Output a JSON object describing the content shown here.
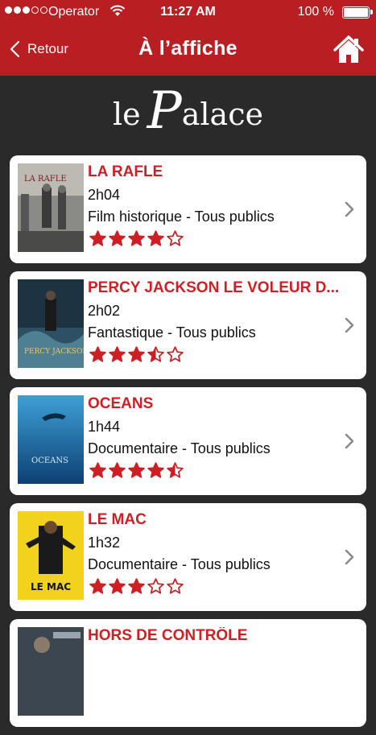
{
  "status_bar": {
    "carrier": "Operator",
    "time": "11:27 AM",
    "battery": "100 %",
    "signal_dots": [
      true,
      true,
      true,
      false,
      false
    ]
  },
  "nav": {
    "back_label": "Retour",
    "title": "À l’affiche",
    "back_icon": "chevron-left-icon",
    "home_icon": "home-icon"
  },
  "logo": {
    "le": "le",
    "p": "P",
    "rest": "alace"
  },
  "colors": {
    "brand_red": "#b81e22",
    "title_red": "#d01e25",
    "background": "#2a2a2a"
  },
  "movies": [
    {
      "title": "LA RAFLE",
      "duration": "2h04",
      "genre": "Film historique - Tous publics",
      "rating": 4,
      "poster_label": "LA RAFLE"
    },
    {
      "title": "PERCY JACKSON LE VOLEUR D...",
      "duration": "2h02",
      "genre": "Fantastique - Tous publics",
      "rating": 3.5,
      "poster_label": "PERCY JACKSON"
    },
    {
      "title": "OCEANS",
      "duration": "1h44",
      "genre": "Documentaire - Tous publics",
      "rating": 4.5,
      "poster_label": "OCEANS"
    },
    {
      "title": "LE MAC",
      "duration": "1h32",
      "genre": "Documentaire - Tous publics",
      "rating": 3,
      "poster_label": "LE MAC"
    },
    {
      "title": "HORS DE CONTRÔLE",
      "duration": "",
      "genre": "",
      "rating": 0,
      "poster_label": ""
    }
  ]
}
